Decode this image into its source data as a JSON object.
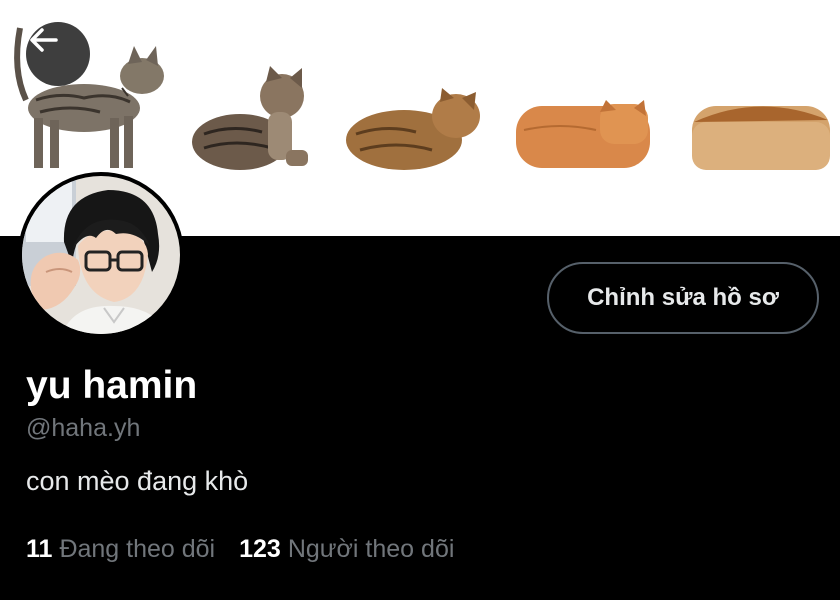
{
  "header": {
    "back_icon": "arrow-left-icon",
    "banner_description_icons": [
      "cat-standing",
      "cat-sitting",
      "cat-crouching",
      "cat-loaf",
      "bread-loaf"
    ]
  },
  "profile": {
    "display_name": "yu hamin",
    "handle": "@haha.yh",
    "bio": "con mèo đang khò",
    "edit_button_label": "Chỉnh sửa hồ sơ",
    "following_count": "11",
    "following_label": "Đang theo dõi",
    "followers_count": "123",
    "followers_label": "Người theo dõi"
  },
  "colors": {
    "background": "#000000",
    "primary_text": "#e7e9ea",
    "secondary_text": "#71767b",
    "button_border": "#56606a"
  }
}
